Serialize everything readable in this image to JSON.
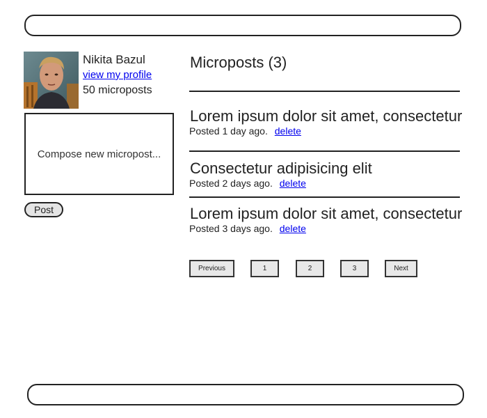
{
  "header": {
    "label": ""
  },
  "footer": {
    "label": ""
  },
  "sidebar": {
    "user_name": "Nikita Bazul",
    "profile_link": "view my profile",
    "micropost_count": "50 microposts",
    "compose_placeholder": "Compose new micropost...",
    "post_button": "Post"
  },
  "main": {
    "title": "Microposts (3)",
    "posts": [
      {
        "content": "Lorem ipsum dolor sit amet, consectetur",
        "meta": "Posted 1 day ago.",
        "delete_label": "delete"
      },
      {
        "content": "Consectetur adipisicing elit",
        "meta": "Posted 2 days ago.",
        "delete_label": "delete"
      },
      {
        "content": "Lorem ipsum dolor sit amet, consectetur",
        "meta": "Posted 3 days ago.",
        "delete_label": "delete"
      }
    ]
  },
  "pagination": {
    "previous": "Previous",
    "pages": [
      "1",
      "2",
      "3"
    ],
    "next": "Next"
  }
}
